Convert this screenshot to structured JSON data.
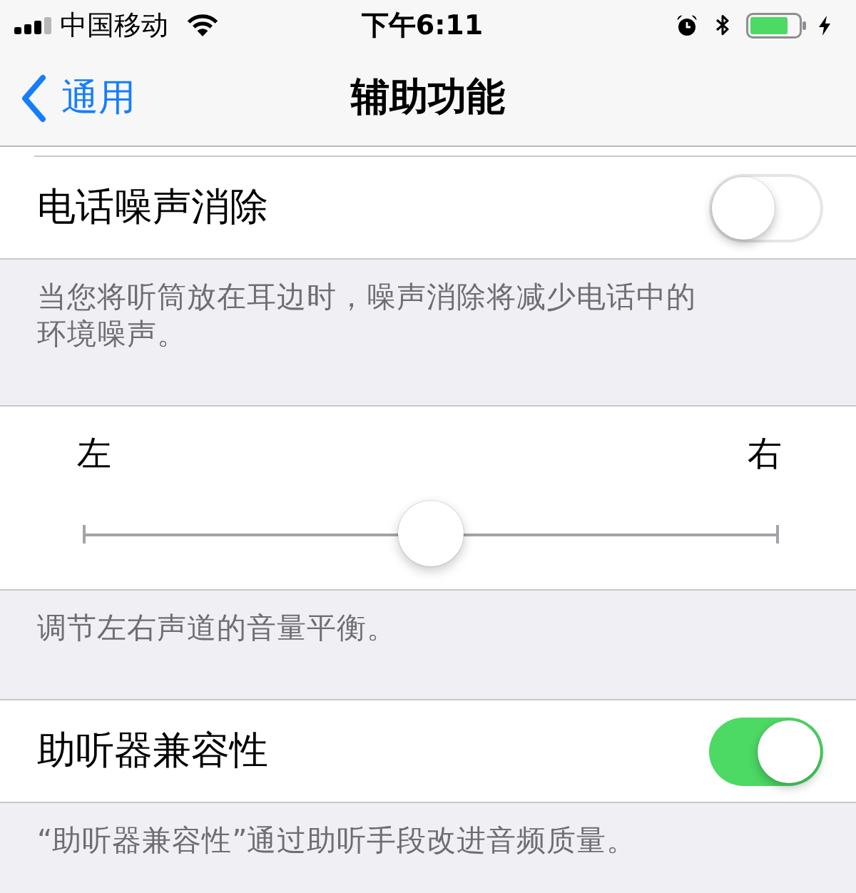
{
  "status_bar": {
    "carrier": "中国移动",
    "time": "下午6:11"
  },
  "nav_bar": {
    "back": "通用",
    "title": "辅助功能"
  },
  "groups": [
    {
      "kind": "toggle",
      "label": "电话噪声消除",
      "on": false,
      "footer": "当您将听筒放在耳边时，噪声消除将减少电话中的环境噪声。"
    },
    {
      "kind": "slider",
      "left_label": "左",
      "right_label": "右",
      "level": 0.5,
      "footer": "调节左右声道的音量平衡。"
    },
    {
      "kind": "toggle",
      "label": "助听器兼容性",
      "on": true,
      "footer": "“助听器兼容性”通过助听手段改进音频质量。"
    }
  ]
}
